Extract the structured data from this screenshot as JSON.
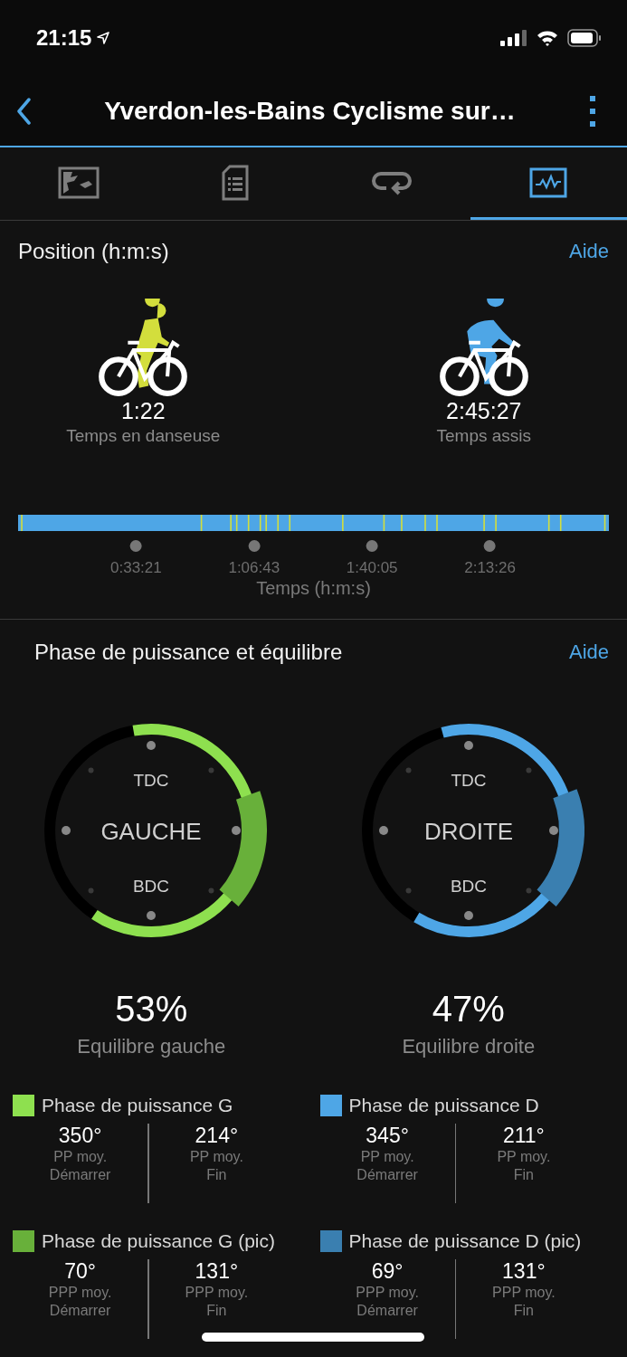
{
  "status_bar": {
    "time": "21:15"
  },
  "header": {
    "title": "Yverdon-les-Bains Cyclisme sur…"
  },
  "tabs": [
    {
      "kind": "map",
      "selected": false
    },
    {
      "kind": "details",
      "selected": false
    },
    {
      "kind": "laps",
      "selected": false
    },
    {
      "kind": "charts",
      "selected": true
    }
  ],
  "position": {
    "title": "Position (h:m:s)",
    "help": "Aide",
    "stats": [
      {
        "value": "1:22",
        "label": "Temps en danseuse",
        "color": "#d3de3c"
      },
      {
        "value": "2:45:27",
        "label": "Temps assis",
        "color": "#4ea6e6"
      }
    ],
    "ticks": [
      "0:33:21",
      "1:06:43",
      "1:40:05",
      "2:13:26"
    ],
    "axis_label": "Temps (h:m:s)"
  },
  "balance": {
    "title": "Phase de puissance et équilibre",
    "help": "Aide",
    "sides": [
      {
        "name": "GAUCHE",
        "top": "TDC",
        "bottom": "BDC",
        "percent": "53%",
        "label": "Equilibre gauche",
        "legend": [
          {
            "title": "Phase de puissance G",
            "color": "#8ee04f",
            "metrics": [
              {
                "value": "350°",
                "label": "PP moy.",
                "sublabel": "Démarrer"
              },
              {
                "value": "214°",
                "label": "PP moy.",
                "sublabel": "Fin"
              }
            ]
          },
          {
            "title": "Phase de puissance G (pic)",
            "color": "#68b03a",
            "metrics": [
              {
                "value": "70°",
                "label": "PPP moy.",
                "sublabel": "Démarrer"
              },
              {
                "value": "131°",
                "label": "PPP moy.",
                "sublabel": "Fin"
              }
            ]
          }
        ]
      },
      {
        "name": "DROITE",
        "top": "TDC",
        "bottom": "BDC",
        "percent": "47%",
        "label": "Equilibre droite",
        "legend": [
          {
            "title": "Phase de puissance D",
            "color": "#4ea6e6",
            "metrics": [
              {
                "value": "345°",
                "label": "PP moy.",
                "sublabel": "Démarrer"
              },
              {
                "value": "211°",
                "label": "PP moy.",
                "sublabel": "Fin"
              }
            ]
          },
          {
            "title": "Phase de puissance D (pic)",
            "color": "#3a7fb0",
            "metrics": [
              {
                "value": "69°",
                "label": "PPP moy.",
                "sublabel": "Démarrer"
              },
              {
                "value": "131°",
                "label": "PPP moy.",
                "sublabel": "Fin"
              }
            ]
          }
        ]
      }
    ]
  }
}
